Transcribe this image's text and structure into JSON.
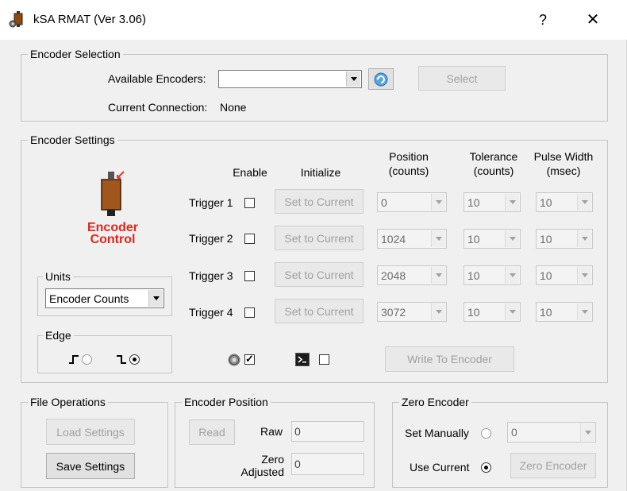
{
  "window": {
    "title": "kSA RMAT  (Ver 3.06)",
    "help_glyph": "?",
    "close_glyph": "✕"
  },
  "encoder_selection": {
    "legend": "Encoder Selection",
    "available_label": "Available Encoders:",
    "available_value": "",
    "select_label": "Select",
    "current_connection_label": "Current Connection:",
    "current_connection_value": "None"
  },
  "encoder_settings": {
    "legend": "Encoder Settings",
    "logo_text_1": "Encoder",
    "logo_text_2": "Control",
    "headers": {
      "enable": "Enable",
      "initialize": "Initialize",
      "position_1": "Position",
      "position_2": "(counts)",
      "tolerance_1": "Tolerance",
      "tolerance_2": "(counts)",
      "pulse_1": "Pulse Width",
      "pulse_2": "(msec)"
    },
    "triggers": [
      {
        "label": "Trigger 1",
        "button": "Set to Current",
        "position": "0",
        "tolerance": "10",
        "pulse": "10"
      },
      {
        "label": "Trigger 2",
        "button": "Set to Current",
        "position": "1024",
        "tolerance": "10",
        "pulse": "10"
      },
      {
        "label": "Trigger 3",
        "button": "Set to Current",
        "position": "2048",
        "tolerance": "10",
        "pulse": "10"
      },
      {
        "label": "Trigger 4",
        "button": "Set to Current",
        "position": "3072",
        "tolerance": "10",
        "pulse": "10"
      }
    ],
    "units": {
      "legend": "Units",
      "value": "Encoder Counts"
    },
    "edge": {
      "legend": "Edge",
      "rising_selected": false,
      "falling_selected": true
    },
    "write_button": "Write To Encoder",
    "gear_checked": true,
    "console_checked": false
  },
  "file_operations": {
    "legend": "File Operations",
    "load_label": "Load Settings",
    "save_label": "Save Settings"
  },
  "encoder_position": {
    "legend": "Encoder Position",
    "read_label": "Read",
    "raw_label": "Raw",
    "raw_value": "0",
    "zero_label_1": "Zero",
    "zero_label_2": "Adjusted",
    "zero_value": "0"
  },
  "zero_encoder": {
    "legend": "Zero Encoder",
    "set_manually_label": "Set Manually",
    "manual_value": "0",
    "use_current_label": "Use Current",
    "zero_button": "Zero Encoder"
  }
}
